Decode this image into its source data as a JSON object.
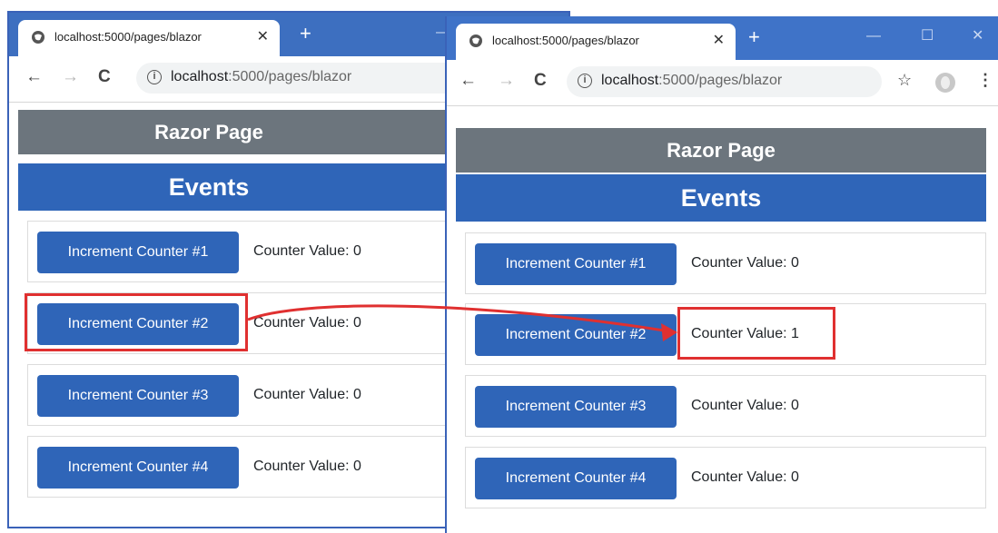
{
  "left_window": {
    "tab_title": "localhost:5000/pages/blazor",
    "url_host": "localhost",
    "url_path": ":5000/pages/blazor",
    "heading": "Razor Page",
    "subheading": "Events",
    "counters": [
      {
        "button": "Increment Counter #1",
        "value_text": "Counter Value: 0"
      },
      {
        "button": "Increment Counter #2",
        "value_text": "Counter Value: 0"
      },
      {
        "button": "Increment Counter #3",
        "value_text": "Counter Value: 0"
      },
      {
        "button": "Increment Counter #4",
        "value_text": "Counter Value: 0"
      }
    ]
  },
  "right_window": {
    "tab_title": "localhost:5000/pages/blazor",
    "url_host": "localhost",
    "url_path": ":5000/pages/blazor",
    "heading": "Razor Page",
    "subheading": "Events",
    "counters": [
      {
        "button": "Increment Counter #1",
        "value_text": "Counter Value: 0"
      },
      {
        "button": "Increment Counter #2",
        "value_text": "Counter Value: 1"
      },
      {
        "button": "Increment Counter #3",
        "value_text": "Counter Value: 0"
      },
      {
        "button": "Increment Counter #4",
        "value_text": "Counter Value: 0"
      }
    ]
  },
  "icons": {
    "favicon": "globe-icon",
    "close": "close-icon",
    "new_tab": "plus-icon",
    "back": "back-arrow-icon",
    "forward": "forward-arrow-icon",
    "reload": "reload-icon",
    "site_info": "info-icon",
    "bookmark": "star-icon",
    "profile": "avatar-icon",
    "menu": "menu-dots-icon"
  },
  "glyphs": {
    "close": "✕",
    "new_tab": "+",
    "back": "←",
    "forward": "→",
    "reload": "C",
    "info": "i",
    "star": "☆",
    "menu": "⋮",
    "minimize": "—",
    "maximize": "☐",
    "window_close": "✕"
  },
  "colors": {
    "titlebar": "#3d6fc0",
    "razor_banner": "#6c757d",
    "events_banner": "#2f65b8",
    "button": "#2f65b8",
    "annotation": "#e03030"
  }
}
